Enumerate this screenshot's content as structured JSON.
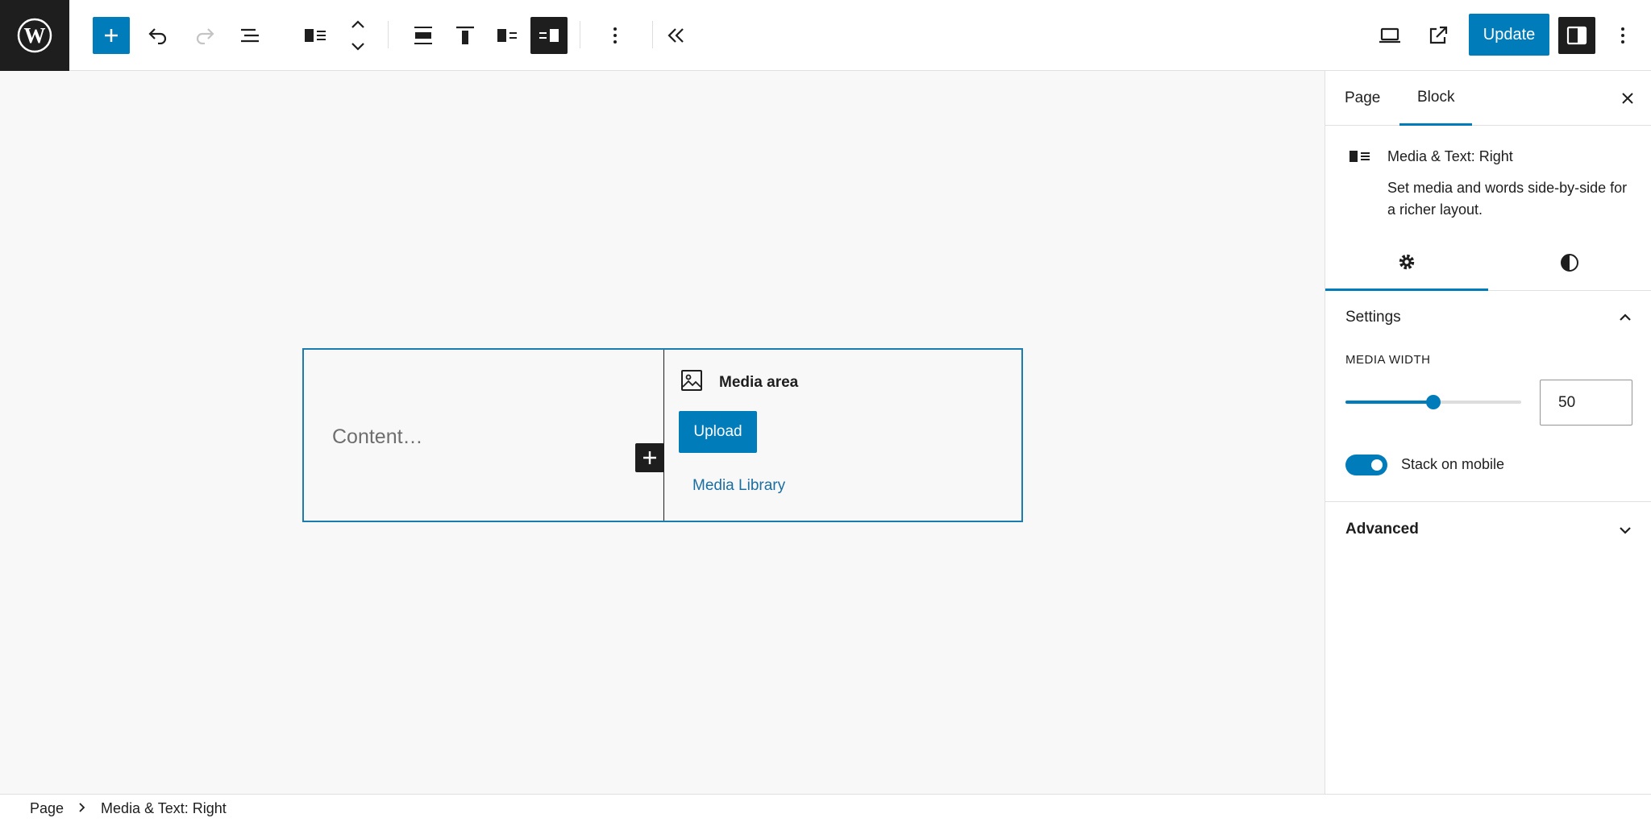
{
  "toolbar": {
    "update_label": "Update",
    "icons": [
      "wordpress-logo",
      "plus-icon",
      "undo-icon",
      "redo-icon",
      "list-view-icon",
      "media-text-icon",
      "move-updown-icon",
      "align-wide-icon",
      "align-top-icon",
      "media-left-icon",
      "media-right-icon",
      "more-vertical-icon",
      "collapse-icon",
      "desktop-icon",
      "external-icon",
      "sidebar-icon",
      "options-icon"
    ],
    "colors": {
      "accent": "#007cba",
      "dark": "#1e1e1e"
    }
  },
  "canvas": {
    "content_placeholder": "Content…",
    "media_area_label": "Media area",
    "upload_label": "Upload",
    "media_library_label": "Media Library"
  },
  "sidebar": {
    "tabs": [
      {
        "label": "Page"
      },
      {
        "label": "Block"
      }
    ],
    "active_tab": "Block",
    "block_title": "Media & Text: Right",
    "block_description": "Set media and words side-by-side for a richer layout.",
    "settings_title": "Settings",
    "media_width_label": "MEDIA WIDTH",
    "media_width_value": "50",
    "media_width_fraction": 0.5,
    "stack_on_mobile_label": "Stack on mobile",
    "stack_on_mobile": true,
    "advanced_title": "Advanced"
  },
  "breadcrumb": {
    "items": [
      {
        "label": "Page"
      },
      {
        "label": "Media & Text: Right"
      }
    ]
  }
}
